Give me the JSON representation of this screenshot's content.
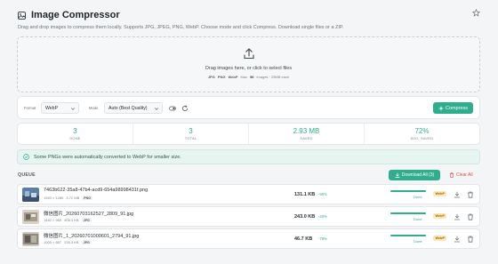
{
  "app": {
    "title": "Image Compressor",
    "subtitle": "Drag and drop images to compress them locally. Supports JPG, JPEG, PNG, WebP. Choose mode and click Compress. Download single files or a ZIP."
  },
  "dropzone": {
    "main_text": "Drag images here, or click to select files",
    "formats": [
      "JPG",
      "PNG",
      "WebP"
    ],
    "limit_prefix": "Max",
    "limit_count": "50",
    "limit_suffix": "images · 25MB each"
  },
  "controls": {
    "format_label": "Format",
    "format_value": "WebP",
    "mode_label": "Mode",
    "mode_value": "Auto (Best Quality)",
    "compress_label": "Compress"
  },
  "stats": [
    {
      "value": "3",
      "label": "DONE"
    },
    {
      "value": "3",
      "label": "TOTAL"
    },
    {
      "value": "2.93 MB",
      "label": "SAVED"
    },
    {
      "value": "72%",
      "label": "AVG. SAVED"
    }
  ],
  "notice": {
    "text": "Some PNGs were automatically converted to WebP for smaller size."
  },
  "queue": {
    "label": "QUEUE",
    "download_all_label": "Download All (3)",
    "clear_all_label": "Clear All",
    "items": [
      {
        "name": "7463b622-35a8-47b4-acd9-654a98998431f.png",
        "dims": "1920 × 1280",
        "orig_size": "3.72 MB",
        "orig_format": "PNG",
        "new_size": "131.1 KB",
        "savings": "-95%",
        "status": "Done",
        "progress": 1.0,
        "out_format": "WebP"
      },
      {
        "name": "微信图片_20260703162527_2809_91.jpg",
        "dims": "1440 × 960",
        "orig_size": "406.3 KB",
        "orig_format": "JPG",
        "new_size": "243.0 KB",
        "savings": "-40%",
        "status": "Done",
        "progress": 1.0,
        "out_format": "WebP"
      },
      {
        "name": "微信图片_1_20260701000601_2794_91.jpg",
        "dims": "1005 × 667",
        "orig_size": "235.3 KB",
        "orig_format": "JPG",
        "new_size": "46.7 KB",
        "savings": "-79%",
        "status": "Done",
        "progress": 1.0,
        "out_format": "WebP"
      }
    ]
  },
  "colors": {
    "accent": "#2fae8e",
    "danger": "#d9534f",
    "badge": "#fbe7b8"
  },
  "icons": {
    "logo": "image-icon",
    "star": "star-icon",
    "upload": "upload-icon",
    "refresh": "refresh-icon",
    "compress": "sparkle-icon",
    "notice": "check-circle-icon",
    "download": "download-icon",
    "trash": "trash-icon"
  }
}
